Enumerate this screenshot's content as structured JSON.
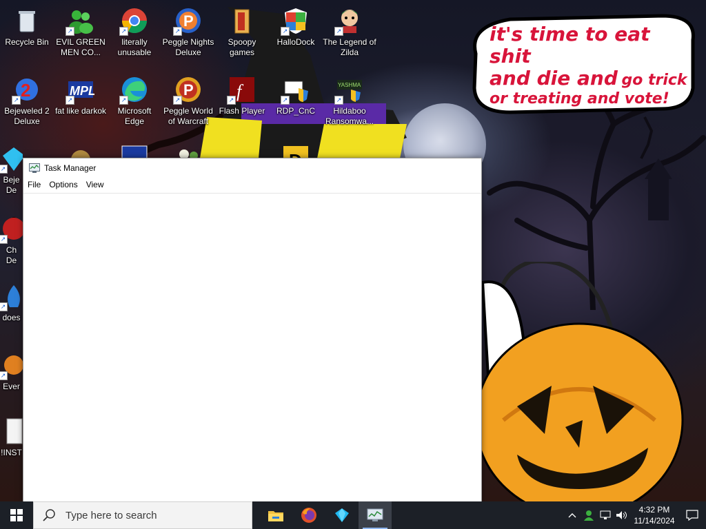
{
  "desktop": {
    "icons": [
      {
        "label": "Recycle Bin"
      },
      {
        "label": "EVIL GREEN MEN CO..."
      },
      {
        "label": "literally unusable"
      },
      {
        "label": "Peggle Nights Deluxe"
      },
      {
        "label": "Spoopy games"
      },
      {
        "label": "HalloDock"
      },
      {
        "label": "The Legend of Zilda"
      },
      {
        "label": "Bejeweled 2 Deluxe"
      },
      {
        "label": "fat like darkok"
      },
      {
        "label": "Microsoft Edge"
      },
      {
        "label": "Peggle World of Warcraft"
      },
      {
        "label": "Flash Player"
      },
      {
        "label": "RDP_CnC"
      },
      {
        "label": "Hildaboo Ransomwa..."
      },
      {
        "label": "Beje De"
      },
      {
        "label": "Ch De"
      },
      {
        "label": "does"
      },
      {
        "label": "Ever"
      },
      {
        "label": "!INST"
      }
    ],
    "wallpaper": {
      "speech_line1": "it's time to eat shit",
      "speech_line2_big": "and die and",
      "speech_line2_small": "go trick",
      "speech_line3": "or treating and vote!",
      "hat_label": "YASHMA"
    }
  },
  "task_manager": {
    "title": "Task Manager",
    "menu": [
      "File",
      "Options",
      "View"
    ]
  },
  "taskbar": {
    "search_placeholder": "Type here to search",
    "time": "4:32 PM",
    "date": "11/14/2024"
  }
}
